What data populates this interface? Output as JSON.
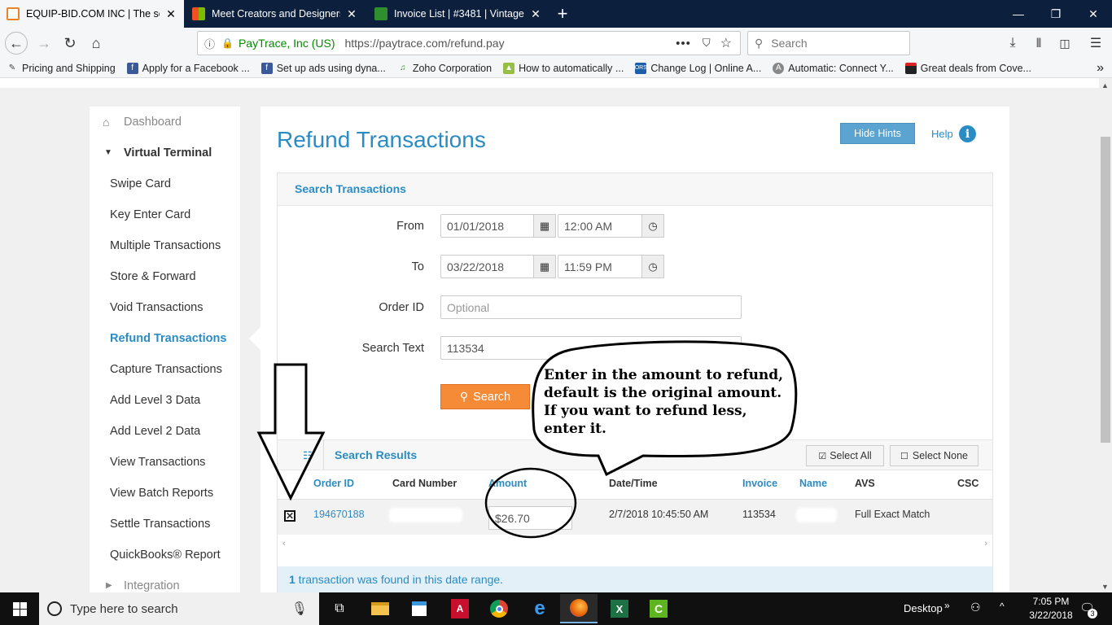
{
  "browser": {
    "tabs": [
      {
        "title": "EQUIP-BID.COM INC | The secu",
        "active": true,
        "favicon_color": "#e8832a"
      },
      {
        "title": "Meet Creators and Designers W",
        "active": false,
        "favicon_color": "#f25022"
      },
      {
        "title": "Invoice List | #3481 | Vintage Lu",
        "active": false,
        "favicon_color": "#2f8f2f"
      }
    ],
    "new_tab_label": "+",
    "window_controls": {
      "minimize": "—",
      "restore": "❐",
      "close": "✕"
    },
    "site_identity": "PayTrace, Inc (US)",
    "url": "https://paytrace.com/refund.pay",
    "search_placeholder": "Search",
    "bookmarks": [
      {
        "label": "Pricing and Shipping",
        "icon": "feather-icon",
        "color": "#444444"
      },
      {
        "label": "Apply for a Facebook ...",
        "icon": "facebook-icon",
        "color": "#3b5998"
      },
      {
        "label": "Set up ads using dyna...",
        "icon": "facebook-icon",
        "color": "#3b5998"
      },
      {
        "label": "Zoho Corporation",
        "icon": "zoho-icon",
        "color": "#2f8f2f"
      },
      {
        "label": "How to automatically ...",
        "icon": "shopify-icon",
        "color": "#96bf48"
      },
      {
        "label": "Change Log | Online A...",
        "icon": "ors-icon",
        "color": "#1f5fa8"
      },
      {
        "label": "Automatic: Connect Y...",
        "icon": "automatic-icon",
        "color": "#888888"
      },
      {
        "label": "Great deals from Cove...",
        "icon": "gift-icon",
        "color": "#222222"
      }
    ]
  },
  "sidebar": {
    "items": [
      {
        "label": "Dashboard",
        "type": "top"
      },
      {
        "label": "Virtual Terminal",
        "type": "section"
      },
      {
        "label": "Swipe Card"
      },
      {
        "label": "Key Enter Card"
      },
      {
        "label": "Multiple Transactions"
      },
      {
        "label": "Store & Forward"
      },
      {
        "label": "Void Transactions"
      },
      {
        "label": "Refund Transactions",
        "active": true
      },
      {
        "label": "Capture Transactions"
      },
      {
        "label": "Add Level 3 Data"
      },
      {
        "label": "Add Level 2 Data"
      },
      {
        "label": "View Transactions"
      },
      {
        "label": "View Batch Reports"
      },
      {
        "label": "Settle Transactions"
      },
      {
        "label": "QuickBooks® Report"
      },
      {
        "label": "Integration",
        "type": "collapsed"
      }
    ]
  },
  "header": {
    "title": "Refund Transactions",
    "hide_hints": "Hide Hints",
    "help": "Help",
    "help_icon_glyph": "i"
  },
  "search": {
    "panel_title": "Search Transactions",
    "from_label": "From",
    "from_date": "01/01/2018",
    "from_time": "12:00 AM",
    "to_label": "To",
    "to_date": "03/22/2018",
    "to_time": "11:59 PM",
    "order_id_label": "Order ID",
    "order_id_placeholder": "Optional",
    "search_text_label": "Search Text",
    "search_text_value": "113534",
    "search_button": "Search"
  },
  "results": {
    "title": "Search Results",
    "select_all": "Select All",
    "select_none": "Select None",
    "columns": [
      "Order ID",
      "Card Number",
      "Amount",
      "Date/Time",
      "Invoice",
      "Name",
      "AVS",
      "CSC"
    ],
    "rows": [
      {
        "order_id": "194670188",
        "amount": "$26.70",
        "datetime": "2/7/2018 10:45:50 AM",
        "invoice": "113534",
        "avs": "Full Exact Match",
        "selected": true
      }
    ],
    "footer_count": "1",
    "footer_text": " transaction was found in this date range."
  },
  "annotation": {
    "callout": "Enter in the amount to refund, default is the original amount.  If you want to refund less, enter it."
  },
  "taskbar": {
    "search_placeholder": "Type here to search",
    "desktop_label": "Desktop",
    "time": "7:05 PM",
    "date": "3/22/2018",
    "notification_count": "3"
  }
}
